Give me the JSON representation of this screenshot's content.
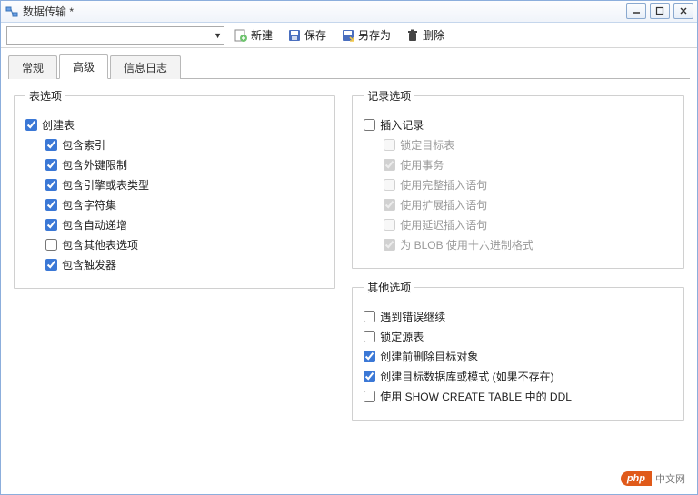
{
  "window": {
    "title": "数据传输 *"
  },
  "toolbar": {
    "new_label": "新建",
    "save_label": "保存",
    "save_as_label": "另存为",
    "delete_label": "删除"
  },
  "tabs": {
    "general": "常规",
    "advanced": "高级",
    "log": "信息日志",
    "active": "advanced"
  },
  "groups": {
    "table_options": {
      "legend": "表选项",
      "create_table": {
        "label": "创建表",
        "checked": true
      },
      "include_index": {
        "label": "包含索引",
        "checked": true
      },
      "include_fk": {
        "label": "包含外键限制",
        "checked": true
      },
      "include_engine": {
        "label": "包含引擎或表类型",
        "checked": true
      },
      "include_charset": {
        "label": "包含字符集",
        "checked": true
      },
      "include_autoincr": {
        "label": "包含自动递增",
        "checked": true
      },
      "include_other": {
        "label": "包含其他表选项",
        "checked": false
      },
      "include_trigger": {
        "label": "包含触发器",
        "checked": true
      }
    },
    "record_options": {
      "legend": "记录选项",
      "insert_records": {
        "label": "插入记录",
        "checked": false
      },
      "lock_target": {
        "label": "锁定目标表",
        "checked": false,
        "disabled": true
      },
      "use_transaction": {
        "label": "使用事务",
        "checked": true,
        "disabled": true
      },
      "complete_insert": {
        "label": "使用完整插入语句",
        "checked": false,
        "disabled": true
      },
      "extended_insert": {
        "label": "使用扩展插入语句",
        "checked": true,
        "disabled": true
      },
      "delayed_insert": {
        "label": "使用延迟插入语句",
        "checked": false,
        "disabled": true
      },
      "blob_hex": {
        "label": "为 BLOB 使用十六进制格式",
        "checked": true,
        "disabled": true
      }
    },
    "other_options": {
      "legend": "其他选项",
      "continue_on_error": {
        "label": "遇到错误继续",
        "checked": false
      },
      "lock_source": {
        "label": "锁定源表",
        "checked": false
      },
      "drop_target_first": {
        "label": "创建前删除目标对象",
        "checked": true
      },
      "create_db_if_missing": {
        "label": "创建目标数据库或模式 (如果不存在)",
        "checked": true
      },
      "use_show_create": {
        "label": "使用 SHOW CREATE TABLE 中的 DDL",
        "checked": false
      }
    }
  },
  "watermark": {
    "badge": "php",
    "text": "中文网"
  }
}
